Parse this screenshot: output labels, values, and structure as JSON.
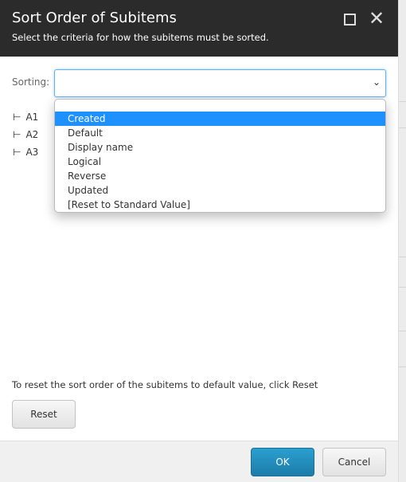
{
  "dialog": {
    "title": "Sort Order of Subitems",
    "subtitle": "Select the criteria for how the subitems must be sorted.",
    "maximize_icon": "square-icon",
    "close_icon": "x-icon"
  },
  "sorting": {
    "label": "Sorting:",
    "value": "",
    "options": [
      "",
      "Created",
      "Default",
      "Display name",
      "Logical",
      "Reverse",
      "Updated",
      "[Reset to Standard Value]"
    ],
    "highlighted": "Created"
  },
  "tree": {
    "items": [
      "A1",
      "A2",
      "A3"
    ],
    "icon": "hierarchy-icon"
  },
  "reset": {
    "text": "To reset the sort order of the subitems to default value, click Reset",
    "button": "Reset"
  },
  "footer": {
    "ok": "OK",
    "cancel": "Cancel"
  },
  "colors": {
    "header": "#2b2b2b",
    "highlight": "#1e90ff",
    "ok": "#2490c0"
  }
}
